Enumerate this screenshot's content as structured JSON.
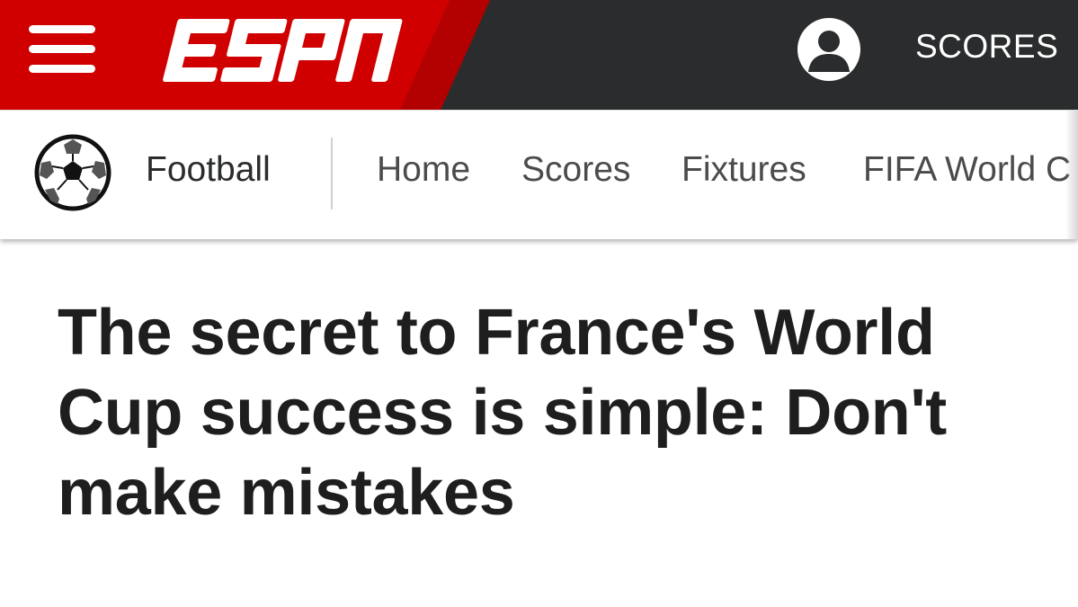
{
  "header": {
    "brand": "ESPN",
    "menu_icon": "hamburger-menu-icon",
    "account_icon": "user-account-icon",
    "scores_label": "SCORES",
    "colors": {
      "red": "#d00000",
      "dark": "#2b2c2d"
    }
  },
  "subnav": {
    "sport_icon": "soccer-ball-icon",
    "section_label": "Football",
    "links": [
      "Home",
      "Scores",
      "Fixtures",
      "FIFA World C"
    ]
  },
  "article": {
    "headline": "The secret to France's World Cup success is simple: Don't make mistakes"
  }
}
